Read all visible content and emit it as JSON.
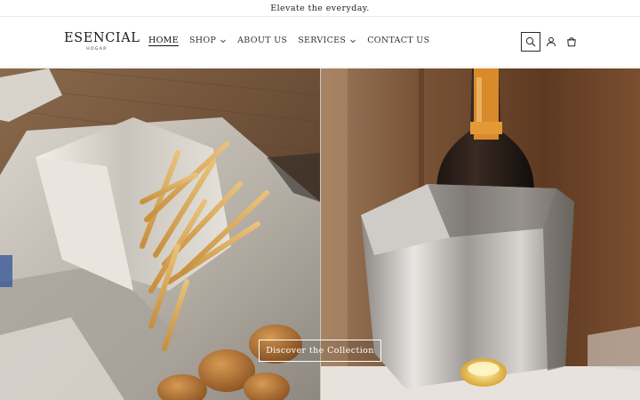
{
  "announcement": {
    "text": "Elevate the everyday."
  },
  "logo": {
    "name": "ESENCIAL",
    "tagline": "HOGAR"
  },
  "nav": {
    "home": "HOME",
    "shop": "SHOP",
    "about": "ABOUT US",
    "services": "SERVICES",
    "contact": "CONTACT US"
  },
  "header_icons": [
    "search-icon",
    "account-icon",
    "cart-icon"
  ],
  "hero": {
    "left_image": "fries-and-nuggets-in-metallic-containers",
    "right_image": "champagne-bottle-in-steel-ice-bucket",
    "cta_label": "Discover the Collection"
  },
  "colors": {
    "text": "#1f1f1f",
    "cta_border": "#ffffff",
    "background": "#ffffff"
  }
}
